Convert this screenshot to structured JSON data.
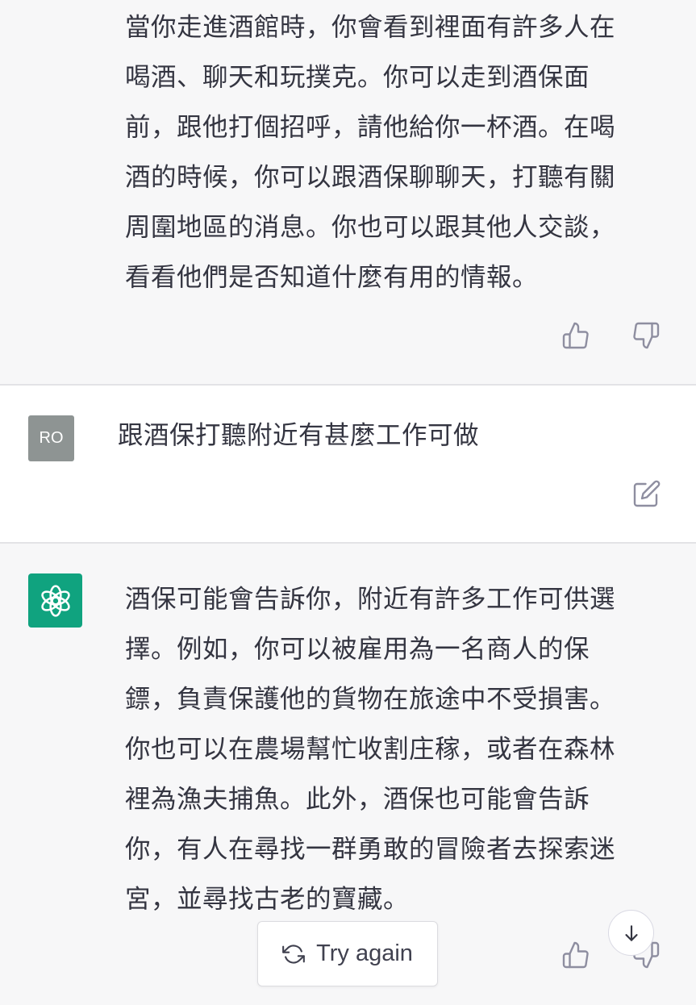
{
  "messages": [
    {
      "role": "assistant",
      "text": "當你走進酒館時，你會看到裡面有許多人在\n喝酒、聊天和玩撲克。你可以走到酒保面\n前，跟他打個招呼，請他給你一杯酒。在喝\n酒的時候，你可以跟酒保聊聊天，打聽有關\n周圍地區的消息。你也可以跟其他人交談，\n看看他們是否知道什麼有用的情報。"
    },
    {
      "role": "user",
      "avatar_initials": "RO",
      "text": "跟酒保打聽附近有甚麼工作可做"
    },
    {
      "role": "assistant",
      "text": "酒保可能會告訴你，附近有許多工作可供選\n擇。例如，你可以被雇用為一名商人的保\n鏢，負責保護他的貨物在旅途中不受損害。\n你也可以在農場幫忙收割庄稼，或者在森林\n裡為漁夫捕魚。此外，酒保也可能會告訴\n你，有人在尋找一群勇敢的冒險者去探索迷\n宮，並尋找古老的寶藏。"
    }
  ],
  "actions": {
    "try_again_label": "Try again",
    "try_again_icon": "refresh-icon",
    "scroll_icon": "arrow-down-icon",
    "thumbs_up_icon": "thumbs-up-icon",
    "thumbs_down_icon": "thumbs-down-icon",
    "edit_icon": "edit-icon"
  },
  "colors": {
    "assistant_bg": "#f7f7f8",
    "user_bg": "#ffffff",
    "bot_avatar": "#10a37f",
    "user_avatar": "#8e9493",
    "text": "#343541",
    "icon": "#acacbe"
  }
}
